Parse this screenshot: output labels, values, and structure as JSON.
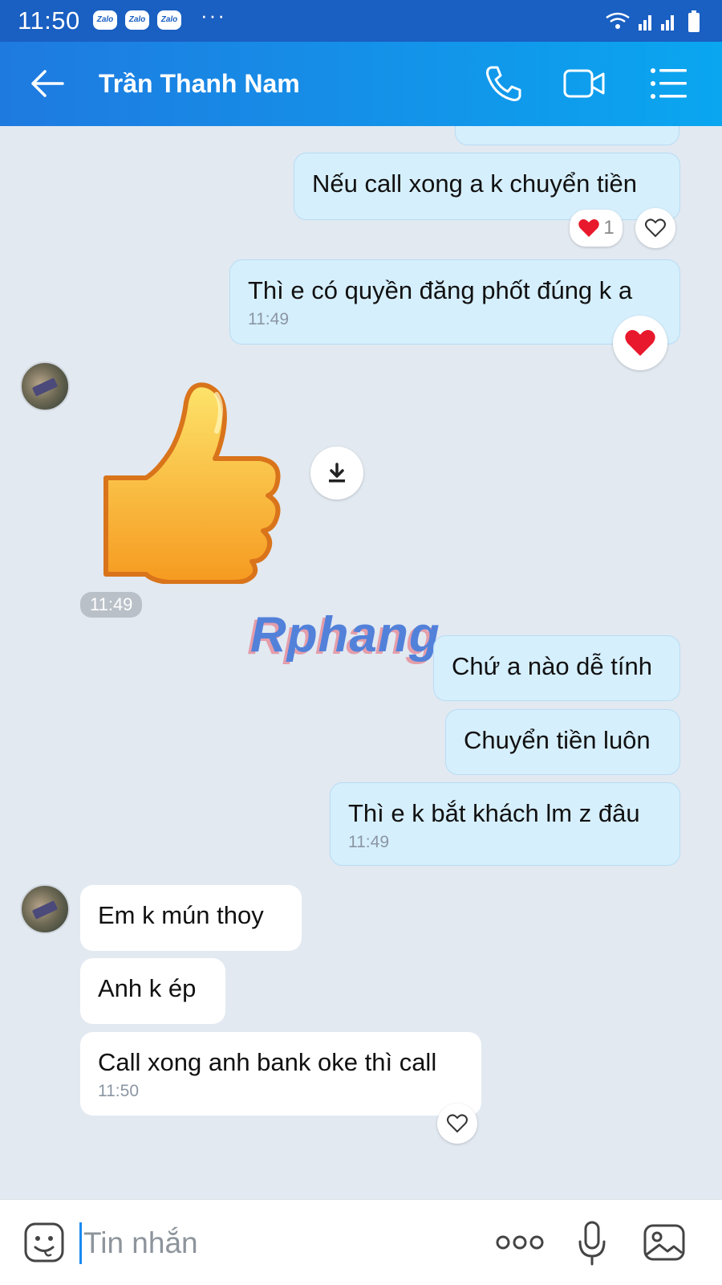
{
  "status_bar": {
    "time": "11:50",
    "app_badges": [
      "Zalo",
      "Zalo",
      "Zalo"
    ],
    "more": "···"
  },
  "header": {
    "contact_name": "Trần Thanh Nam",
    "icons": [
      "back-arrow-icon",
      "phone-icon",
      "video-icon",
      "menu-list-icon"
    ]
  },
  "messages": {
    "m1_text": "Nếu call xong a k chuyển tiền",
    "m1_reaction_count": "1",
    "m2_text": "Thì e có quyền đăng phốt đúng k a",
    "m2_time": "11:49",
    "sticker_time": "11:49",
    "m3_text": "Chứ a nào dễ tính",
    "m4_text": "Chuyển tiền luôn",
    "m5_text": "Thì e k bắt khách lm z đâu",
    "m5_time": "11:49",
    "r1_text": "Em k mún thoy",
    "r2_text": "Anh k ép",
    "r3_text": "Call xong anh bank oke thì call",
    "r3_time": "11:50"
  },
  "watermark": "Rphang",
  "composer": {
    "placeholder": "Tin nhắn",
    "more": "ooo"
  },
  "colors": {
    "header_start": "#1f7ae0",
    "header_end": "#0aa6f0",
    "my_bubble": "#d6effd",
    "their_bubble": "#ffffff",
    "chat_bg": "#e2e9f1",
    "heart": "#e8192c"
  }
}
